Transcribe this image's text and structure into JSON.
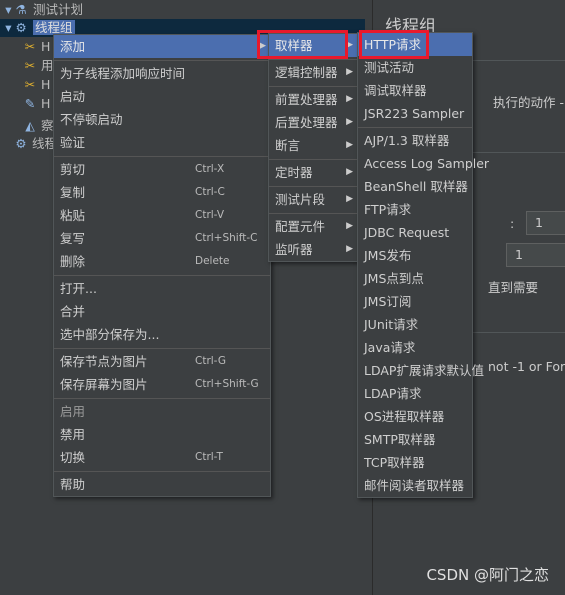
{
  "tree": {
    "items": [
      {
        "label": "测试计划",
        "icon": "flask-icon"
      },
      {
        "label": "线程组",
        "icon": "gear-icon",
        "selected": true
      },
      {
        "label": "H",
        "icon": "wrench-icon"
      },
      {
        "label": "用",
        "icon": "wrench-icon"
      },
      {
        "label": "H",
        "icon": "wrench-icon"
      },
      {
        "label": "H",
        "icon": "dropper-icon"
      },
      {
        "label": "察",
        "icon": "chart-icon"
      },
      {
        "label": "线程",
        "icon": "gear-icon"
      }
    ]
  },
  "right": {
    "title": "线程组",
    "t1": "执行的动作 -",
    "t2": ":",
    "v1": "1",
    "v2": "1",
    "t3": "直到需要",
    "t4": "not -1 or For"
  },
  "menu1": [
    {
      "label": "添加",
      "arrow": true,
      "hl": true
    },
    {
      "sep": true
    },
    {
      "label": "为子线程添加响应时间"
    },
    {
      "label": "启动"
    },
    {
      "label": "不停顿启动"
    },
    {
      "label": "验证"
    },
    {
      "sep": true
    },
    {
      "label": "剪切",
      "sc": "Ctrl-X"
    },
    {
      "label": "复制",
      "sc": "Ctrl-C"
    },
    {
      "label": "粘贴",
      "sc": "Ctrl-V"
    },
    {
      "label": "复写",
      "sc": "Ctrl+Shift-C"
    },
    {
      "label": "删除",
      "sc": "Delete"
    },
    {
      "sep": true
    },
    {
      "label": "打开..."
    },
    {
      "label": "合并"
    },
    {
      "label": "选中部分保存为..."
    },
    {
      "sep": true
    },
    {
      "label": "保存节点为图片",
      "sc": "Ctrl-G"
    },
    {
      "label": "保存屏幕为图片",
      "sc": "Ctrl+Shift-G"
    },
    {
      "sep": true
    },
    {
      "label": "启用",
      "dis": true
    },
    {
      "label": "禁用"
    },
    {
      "label": "切换",
      "sc": "Ctrl-T"
    },
    {
      "sep": true
    },
    {
      "label": "帮助"
    }
  ],
  "menu2": [
    {
      "label": "取样器",
      "arrow": true,
      "hl": true
    },
    {
      "sep": true
    },
    {
      "label": "逻辑控制器",
      "arrow": true
    },
    {
      "sep": true
    },
    {
      "label": "前置处理器",
      "arrow": true
    },
    {
      "label": "后置处理器",
      "arrow": true
    },
    {
      "label": "断言",
      "arrow": true
    },
    {
      "sep": true
    },
    {
      "label": "定时器",
      "arrow": true
    },
    {
      "sep": true
    },
    {
      "label": "测试片段",
      "arrow": true
    },
    {
      "sep": true
    },
    {
      "label": "配置元件",
      "arrow": true
    },
    {
      "label": "监听器",
      "arrow": true
    }
  ],
  "menu3": [
    {
      "label": "HTTP请求",
      "hl": true
    },
    {
      "label": "测试活动"
    },
    {
      "label": "调试取样器"
    },
    {
      "label": "JSR223 Sampler"
    },
    {
      "sep": true
    },
    {
      "label": "AJP/1.3 取样器"
    },
    {
      "label": "Access Log Sampler"
    },
    {
      "label": "BeanShell 取样器"
    },
    {
      "label": "FTP请求"
    },
    {
      "label": "JDBC Request"
    },
    {
      "label": "JMS发布"
    },
    {
      "label": "JMS点到点"
    },
    {
      "label": "JMS订阅"
    },
    {
      "label": "JUnit请求"
    },
    {
      "label": "Java请求"
    },
    {
      "label": "LDAP扩展请求默认值"
    },
    {
      "label": "LDAP请求"
    },
    {
      "label": "OS进程取样器"
    },
    {
      "label": "SMTP取样器"
    },
    {
      "label": "TCP取样器"
    },
    {
      "label": "邮件阅读者取样器"
    }
  ],
  "watermark": "CSDN @阿门之恋",
  "colors": {
    "highlight": "#4b6eaf",
    "annotation": "#e8192c",
    "background": "#3c3f41"
  }
}
